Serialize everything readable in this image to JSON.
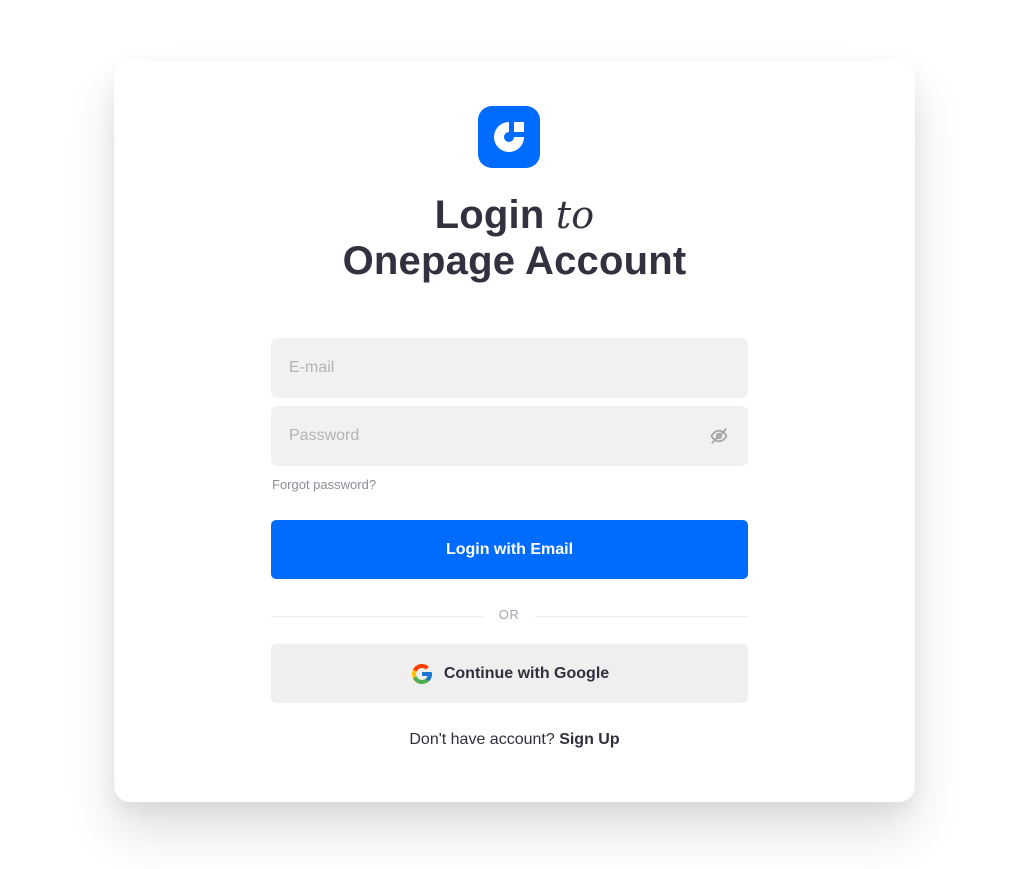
{
  "brand": {
    "logo_icon": "onepage-logo-icon",
    "accent_color": "#006cff"
  },
  "heading": {
    "line1_bold": "Login",
    "line1_italic": "to",
    "line2": "Onepage Account"
  },
  "form": {
    "email_placeholder": "E-mail",
    "email_value": "",
    "password_placeholder": "Password",
    "password_value": "",
    "password_toggle_icon": "eye-off-icon",
    "forgot_password": "Forgot password?",
    "login_button": "Login with Email"
  },
  "divider": {
    "label": "OR"
  },
  "google": {
    "icon": "google-icon",
    "label": "Continue with Google"
  },
  "footer": {
    "prompt": "Don't have account?",
    "signup_link": "Sign Up"
  }
}
